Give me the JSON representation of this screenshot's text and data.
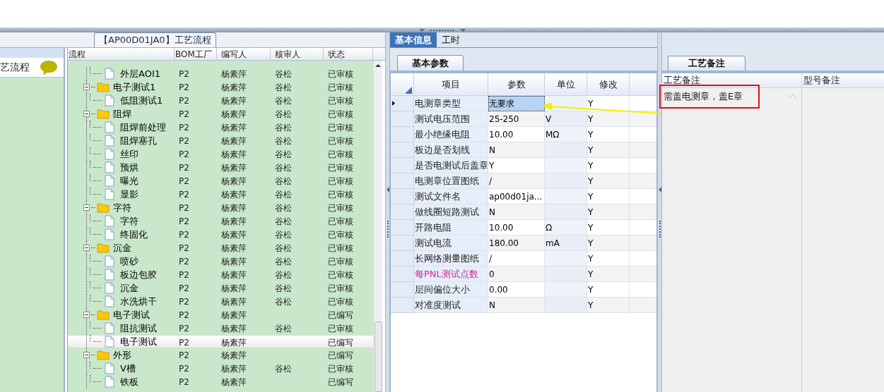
{
  "left_panel": {
    "title": "艺流程"
  },
  "process_tab": {
    "label": "【AP00D01JA0】工艺流程"
  },
  "process_tree": {
    "columns": [
      "流程",
      "BOM工厂",
      "编写人",
      "核审人",
      "状态"
    ],
    "rows": [
      {
        "children": [
          {
            "kind": "file",
            "label": "外层AOI1",
            "factory": "P2",
            "writer": "杨素萍",
            "reviewer": "谷松",
            "status": "已审核",
            "selected": false
          }
        ]
      },
      {
        "kind": "folder",
        "label": "电子测试1",
        "factory": "P2",
        "writer": "杨素萍",
        "reviewer": "谷松",
        "status": "已审核",
        "selected": false,
        "expanded": true,
        "children": [
          {
            "kind": "file",
            "label": "低阻测试1",
            "factory": "P2",
            "writer": "杨素萍",
            "reviewer": "谷松",
            "status": "已审核",
            "selected": false
          }
        ]
      },
      {
        "kind": "folder",
        "label": "阻焊",
        "factory": "P2",
        "writer": "杨素萍",
        "reviewer": "谷松",
        "status": "已审核",
        "selected": false,
        "expanded": true,
        "children": [
          {
            "kind": "file",
            "label": "阻焊前处理",
            "factory": "P2",
            "writer": "杨素萍",
            "reviewer": "谷松",
            "status": "已审核",
            "selected": false
          },
          {
            "kind": "file",
            "label": "阻焊塞孔",
            "factory": "P2",
            "writer": "杨素萍",
            "reviewer": "谷松",
            "status": "已审核",
            "selected": false
          },
          {
            "kind": "file",
            "label": "丝印",
            "factory": "P2",
            "writer": "杨素萍",
            "reviewer": "谷松",
            "status": "已审核",
            "selected": false
          },
          {
            "kind": "file",
            "label": "预烘",
            "factory": "P2",
            "writer": "杨素萍",
            "reviewer": "谷松",
            "status": "已审核",
            "selected": false
          },
          {
            "kind": "file",
            "label": "曝光",
            "factory": "P2",
            "writer": "杨素萍",
            "reviewer": "谷松",
            "status": "已审核",
            "selected": false
          },
          {
            "kind": "file",
            "label": "显影",
            "factory": "P2",
            "writer": "杨素萍",
            "reviewer": "谷松",
            "status": "已审核",
            "selected": false
          }
        ]
      },
      {
        "kind": "folder",
        "label": "字符",
        "factory": "P2",
        "writer": "杨素萍",
        "reviewer": "谷松",
        "status": "已审核",
        "selected": false,
        "expanded": true,
        "children": [
          {
            "kind": "file",
            "label": "字符",
            "factory": "P2",
            "writer": "杨素萍",
            "reviewer": "谷松",
            "status": "已审核",
            "selected": false
          },
          {
            "kind": "file",
            "label": "终固化",
            "factory": "P2",
            "writer": "杨素萍",
            "reviewer": "谷松",
            "status": "已审核",
            "selected": false
          }
        ]
      },
      {
        "kind": "folder",
        "label": "沉金",
        "factory": "P2",
        "writer": "杨素萍",
        "reviewer": "谷松",
        "status": "已审核",
        "selected": false,
        "expanded": true,
        "children": [
          {
            "kind": "file",
            "label": "喷砂",
            "factory": "P2",
            "writer": "杨素萍",
            "reviewer": "谷松",
            "status": "已审核",
            "selected": false
          },
          {
            "kind": "file",
            "label": "板边包胶",
            "factory": "P2",
            "writer": "杨素萍",
            "reviewer": "谷松",
            "status": "已审核",
            "selected": false
          },
          {
            "kind": "file",
            "label": "沉金",
            "factory": "P2",
            "writer": "杨素萍",
            "reviewer": "谷松",
            "status": "已审核",
            "selected": false
          },
          {
            "kind": "file",
            "label": "水洗烘干",
            "factory": "P2",
            "writer": "杨素萍",
            "reviewer": "谷松",
            "status": "已审核",
            "selected": false
          }
        ]
      },
      {
        "kind": "folder",
        "label": "电子测试",
        "factory": "P2",
        "writer": "杨素萍",
        "status": "已编写",
        "selected": false,
        "expanded": true,
        "children": [
          {
            "kind": "file",
            "label": "阻抗测试",
            "factory": "P2",
            "writer": "杨素萍",
            "reviewer": "谷松",
            "status": "已审核",
            "selected": false
          },
          {
            "kind": "file",
            "label": "电子测试",
            "factory": "P2",
            "writer": "杨素萍",
            "status": "已编写",
            "selected": true
          }
        ]
      },
      {
        "kind": "folder",
        "label": "外形",
        "factory": "P2",
        "writer": "杨素萍",
        "status": "已编写",
        "selected": false,
        "expanded": true,
        "children": [
          {
            "kind": "file",
            "label": "V槽",
            "factory": "P2",
            "writer": "杨素萍",
            "reviewer": "谷松",
            "status": "已审核",
            "selected": false
          },
          {
            "kind": "file",
            "label": "铁板",
            "factory": "P2",
            "writer": "杨素萍",
            "status": "已编写",
            "selected": false
          }
        ]
      }
    ]
  },
  "info_tabs": [
    {
      "label": "基本信息",
      "selected": true
    },
    {
      "label": "工时",
      "selected": false
    }
  ],
  "param_tab": {
    "label": "基本参数"
  },
  "param_grid": {
    "columns": [
      "项目",
      "参数",
      "单位",
      "修改"
    ],
    "rows": [
      {
        "item": "电测章类型",
        "value": "无要求",
        "modify": "Y",
        "selected": true
      },
      {
        "item": "测试电压范围",
        "value": "25-250",
        "unit": "V",
        "modify": "Y",
        "selected": false
      },
      {
        "item": "最小绝缘电阻",
        "value": "10.00",
        "unit": "MΩ",
        "modify": "Y",
        "selected": false
      },
      {
        "item": "板边是否划线",
        "value": "N",
        "modify": "Y",
        "selected": false
      },
      {
        "item": "是否电测试后盖章",
        "value": "Y",
        "modify": "Y",
        "selected": false
      },
      {
        "item": "电测章位置图纸",
        "value": "/",
        "modify": "Y",
        "selected": false
      },
      {
        "item": "测试文件名",
        "value": "ap00d01ja...",
        "modify": "Y",
        "selected": false
      },
      {
        "item": "做线圈短路测试",
        "value": "N",
        "modify": "Y",
        "selected": false
      },
      {
        "item": "开路电阻",
        "value": "10.00",
        "unit": "Ω",
        "modify": "Y",
        "selected": false
      },
      {
        "item": "测试电流",
        "value": "180.00",
        "unit": "mA",
        "modify": "Y",
        "selected": false
      },
      {
        "item": "长网络测量图纸",
        "value": "/",
        "modify": "Y",
        "selected": false
      },
      {
        "item": "每PNL测试点数",
        "value": "0",
        "modify": "Y",
        "selected": false,
        "highlighted": true
      },
      {
        "item": "层间偏位大小",
        "value": "0.00",
        "modify": "Y",
        "selected": false
      },
      {
        "item": "对准度测试",
        "value": "N",
        "modify": "Y",
        "selected": false
      }
    ]
  },
  "note_tab": {
    "label": "工艺备注"
  },
  "notes_grid": {
    "columns": [
      "工艺备注",
      "型号备注"
    ],
    "rows": [
      {
        "process_note": "需盖电测章，盖E章"
      }
    ]
  }
}
